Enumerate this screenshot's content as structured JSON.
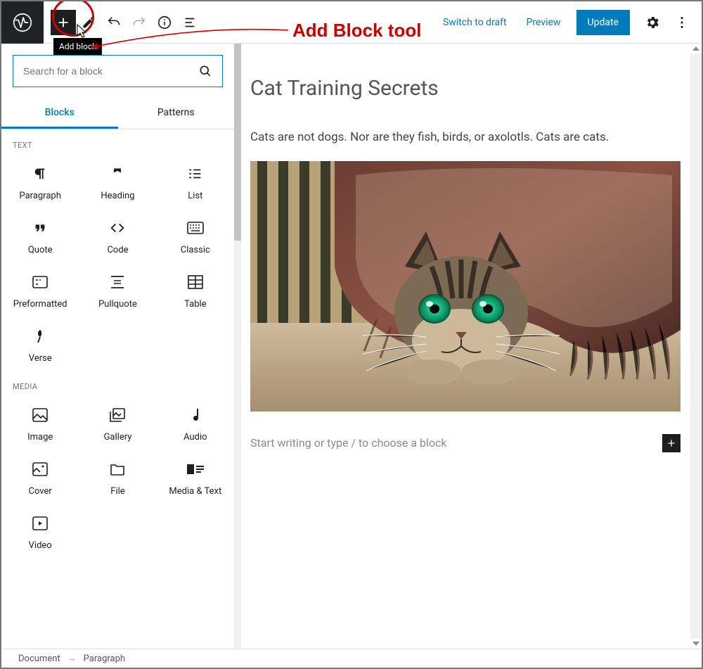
{
  "annotation": {
    "label": "Add Block tool"
  },
  "topbar": {
    "tooltip": "Add block",
    "switch_draft": "Switch to draft",
    "preview": "Preview",
    "update": "Update"
  },
  "inserter": {
    "search_placeholder": "Search for a block",
    "tabs": {
      "blocks": "Blocks",
      "patterns": "Patterns"
    },
    "cat_text": "TEXT",
    "cat_media": "MEDIA",
    "blocks_text": {
      "paragraph": "Paragraph",
      "heading": "Heading",
      "list": "List",
      "quote": "Quote",
      "code": "Code",
      "classic": "Classic",
      "preformatted": "Preformatted",
      "pullquote": "Pullquote",
      "table": "Table",
      "verse": "Verse"
    },
    "blocks_media": {
      "image": "Image",
      "gallery": "Gallery",
      "audio": "Audio",
      "cover": "Cover",
      "file": "File",
      "media_text": "Media & Text",
      "video": "Video"
    }
  },
  "post": {
    "title": "Cat Training Secrets",
    "paragraph": "Cats are not dogs. Nor are they fish, birds, or axolotls. Cats are cats.",
    "placeholder": "Start writing or type / to choose a block"
  },
  "footer": {
    "crumb1": "Document",
    "crumb2": "Paragraph"
  }
}
